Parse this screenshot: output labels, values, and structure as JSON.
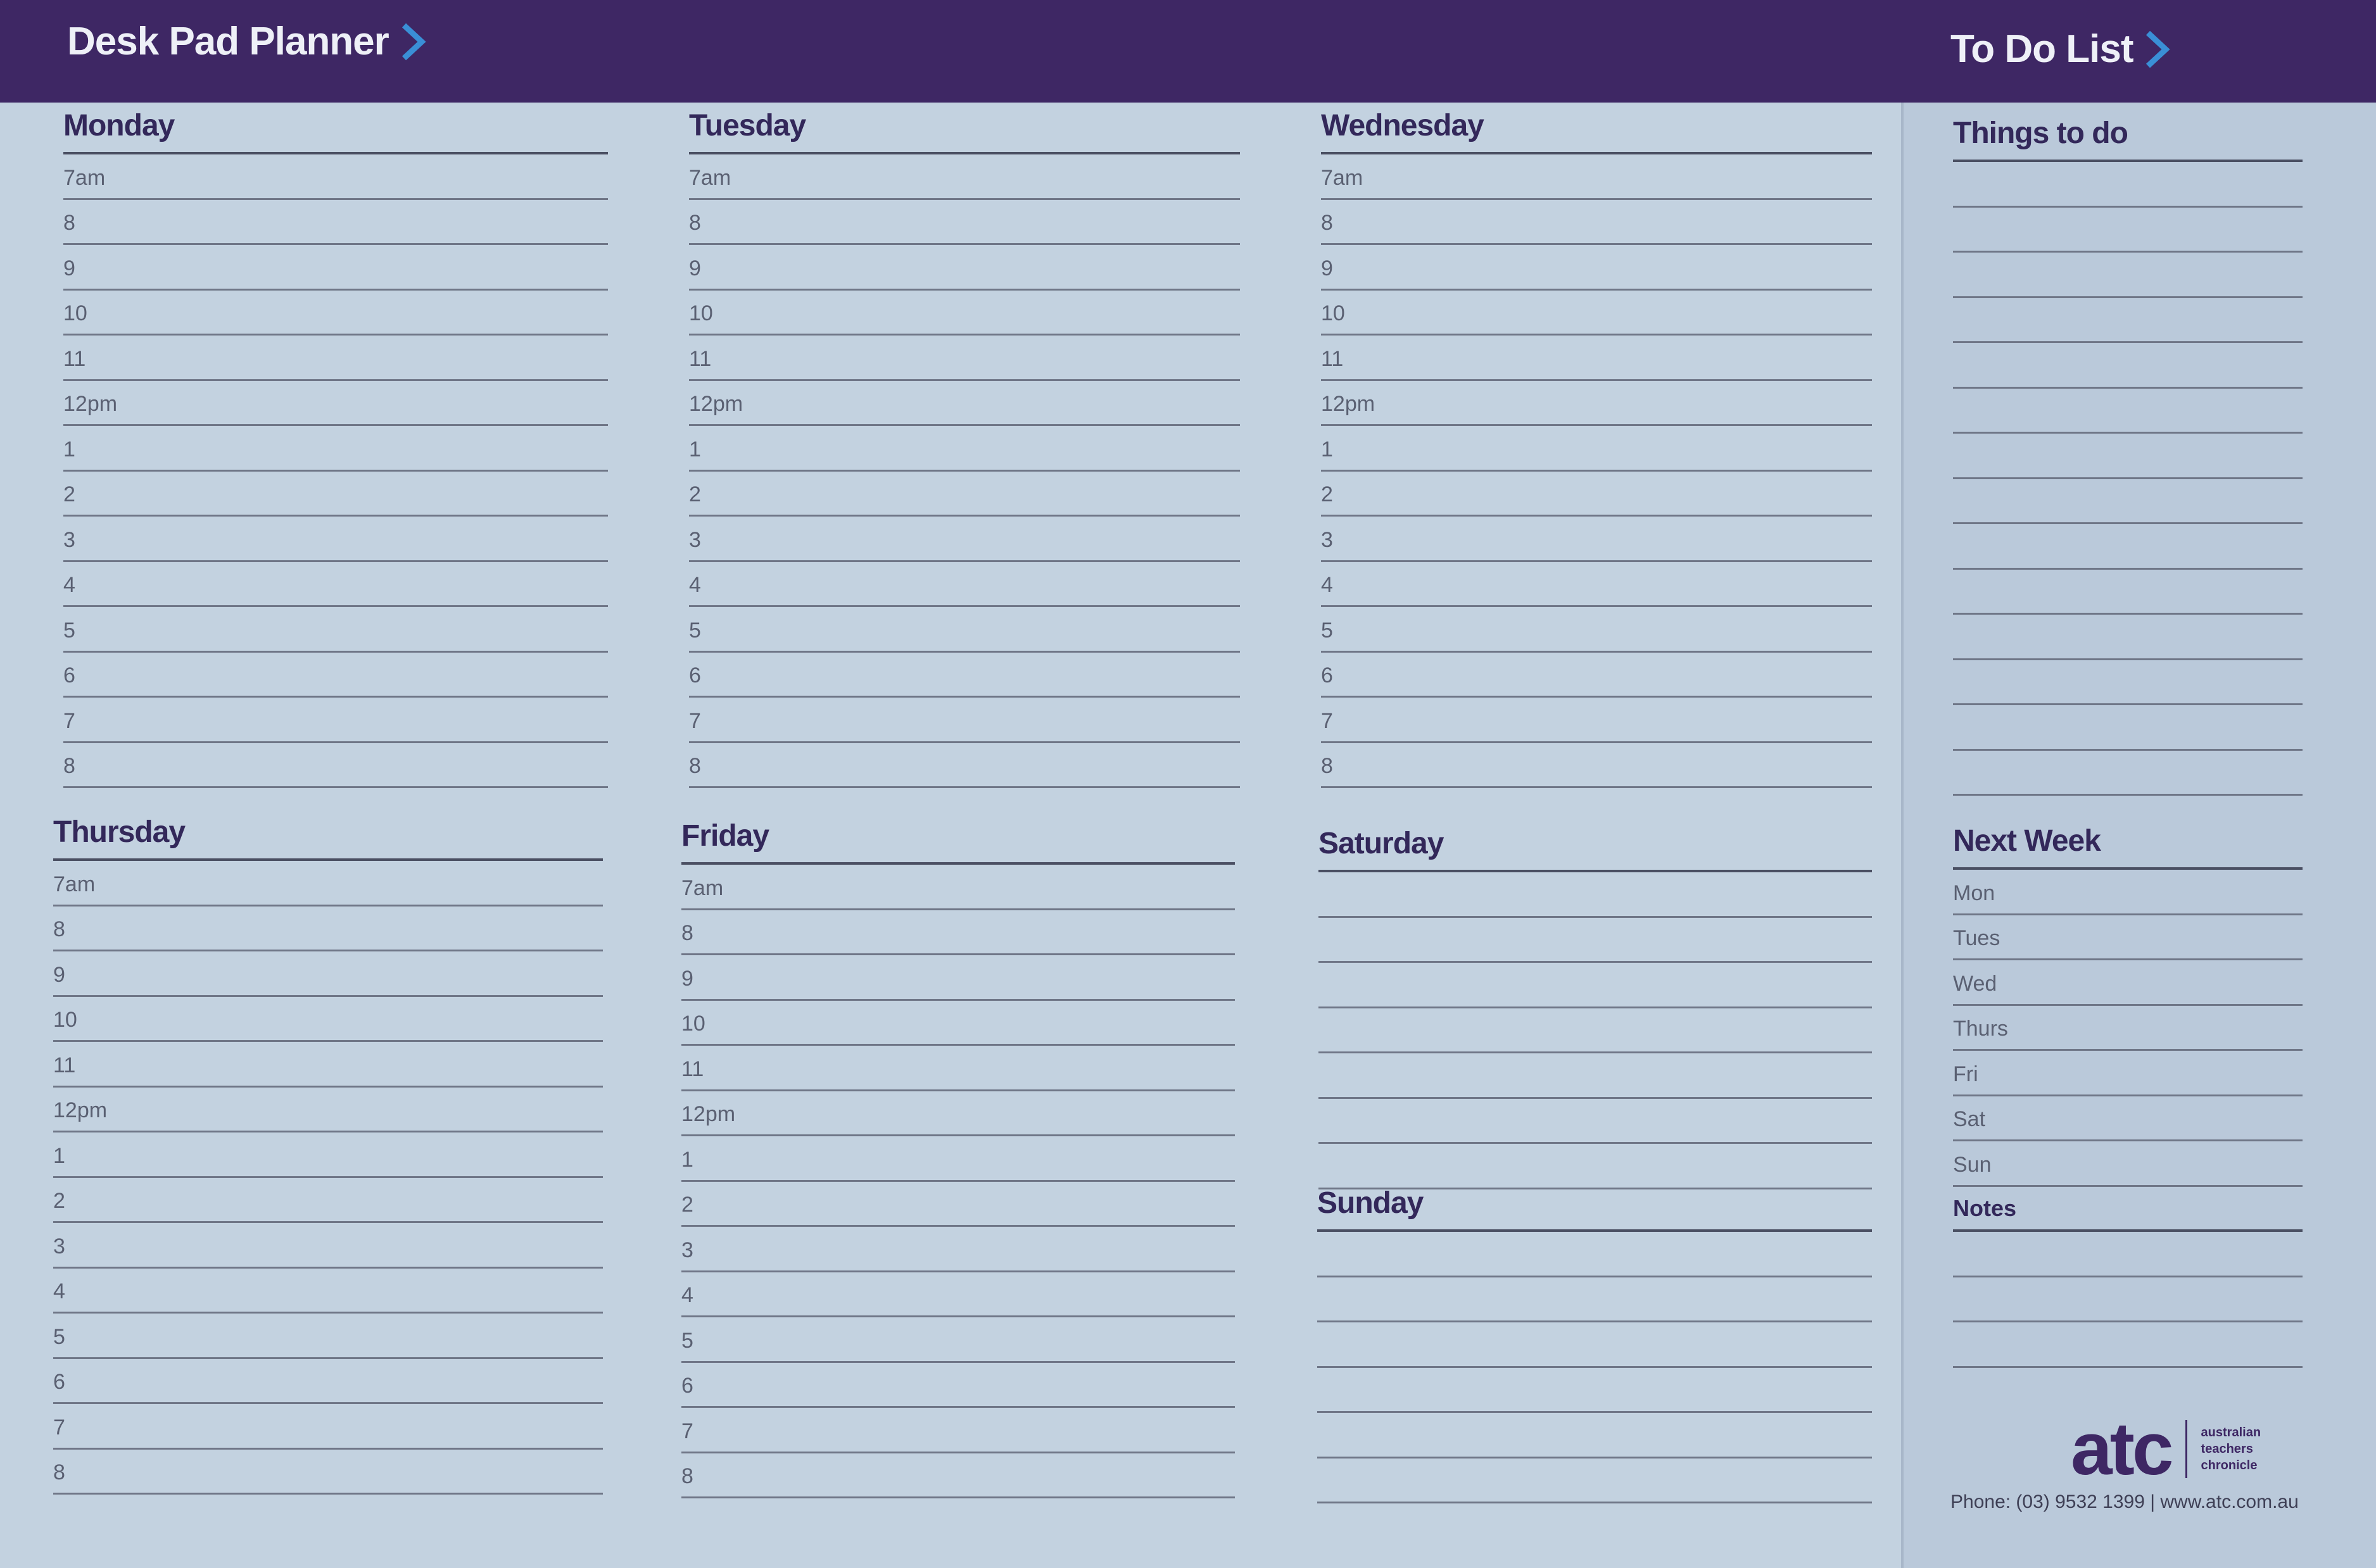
{
  "header": {
    "title": "Desk Pad Planner",
    "todo_title": "To Do List",
    "background_color": "#3e2764",
    "arrow_color": "#3a8fd6"
  },
  "hours": [
    "7am",
    "8",
    "9",
    "10",
    "11",
    "12pm",
    "1",
    "2",
    "3",
    "4",
    "5",
    "6",
    "7",
    "8"
  ],
  "days": {
    "monday": "Monday",
    "tuesday": "Tuesday",
    "wednesday": "Wednesday",
    "thursday": "Thursday",
    "friday": "Friday",
    "saturday": "Saturday",
    "sunday": "Sunday"
  },
  "todo": {
    "things_title": "Things to do",
    "next_week_title": "Next Week",
    "next_week_days": [
      "Mon",
      "Tues",
      "Wed",
      "Thurs",
      "Fri",
      "Sat",
      "Sun"
    ],
    "notes_label": "Notes"
  },
  "footer": {
    "logo_text": "atc",
    "logo_subtext": [
      "australian",
      "teachers",
      "chronicle"
    ],
    "contact": "Phone: (03) 9532 1399 | www.atc.com.au"
  }
}
